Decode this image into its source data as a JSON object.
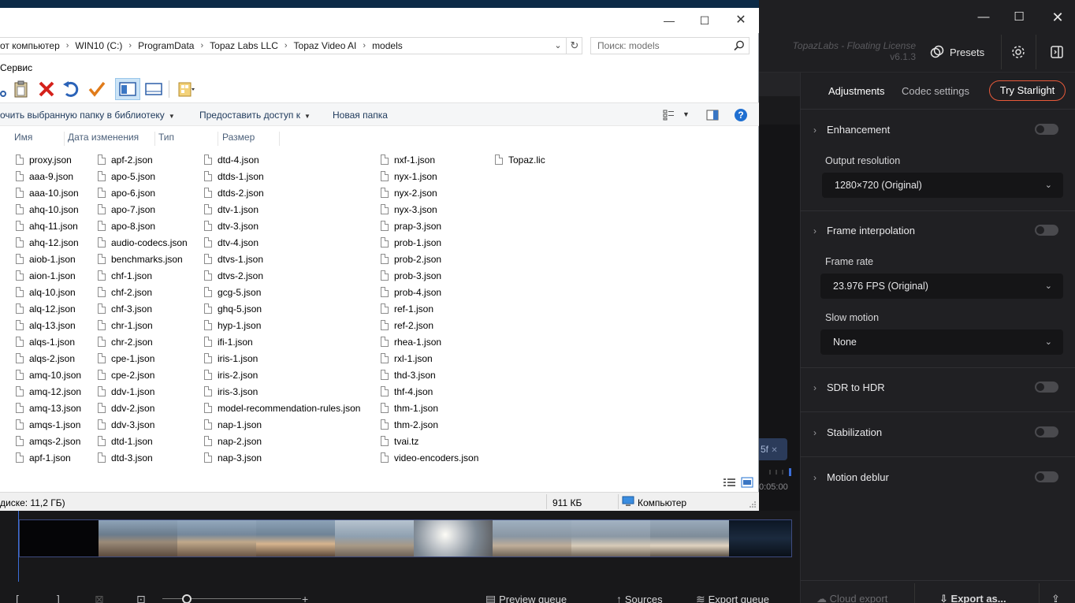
{
  "explorer": {
    "breadcrumb": [
      "от компьютер",
      "WIN10 (C:)",
      "ProgramData",
      "Topaz Labs LLC",
      "Topaz Video AI",
      "models"
    ],
    "search_placeholder": "Поиск: models",
    "menu_service": "Сервис",
    "commands": {
      "include_library": "очить выбранную папку в библиотеку",
      "share": "Предоставить доступ к",
      "new_folder": "Новая папка"
    },
    "columns": [
      "Имя",
      "Дата изменения",
      "Тип",
      "Размер"
    ],
    "files": {
      "col1": [
        "proxy.json",
        "aaa-9.json",
        "aaa-10.json",
        "ahq-10.json",
        "ahq-11.json",
        "ahq-12.json",
        "aiob-1.json",
        "aion-1.json",
        "alq-10.json",
        "alq-12.json",
        "alq-13.json",
        "alqs-1.json",
        "alqs-2.json",
        "amq-10.json",
        "amq-12.json",
        "amq-13.json",
        "amqs-1.json",
        "amqs-2.json",
        "apf-1.json"
      ],
      "col2": [
        "apf-2.json",
        "apo-5.json",
        "apo-6.json",
        "apo-7.json",
        "apo-8.json",
        "audio-codecs.json",
        "benchmarks.json",
        "chf-1.json",
        "chf-2.json",
        "chf-3.json",
        "chr-1.json",
        "chr-2.json",
        "cpe-1.json",
        "cpe-2.json",
        "ddv-1.json",
        "ddv-2.json",
        "ddv-3.json",
        "dtd-1.json",
        "dtd-3.json"
      ],
      "col3": [
        "dtd-4.json",
        "dtds-1.json",
        "dtds-2.json",
        "dtv-1.json",
        "dtv-3.json",
        "dtv-4.json",
        "dtvs-1.json",
        "dtvs-2.json",
        "gcg-5.json",
        "ghq-5.json",
        "hyp-1.json",
        "ifi-1.json",
        "iris-1.json",
        "iris-2.json",
        "iris-3.json",
        "model-recommendation-rules.json",
        "nap-1.json",
        "nap-2.json",
        "nap-3.json"
      ],
      "col4": [
        "nxf-1.json",
        "nyx-1.json",
        "nyx-2.json",
        "nyx-3.json",
        "prap-3.json",
        "prob-1.json",
        "prob-2.json",
        "prob-3.json",
        "prob-4.json",
        "ref-1.json",
        "ref-2.json",
        "rhea-1.json",
        "rxl-1.json",
        "thd-3.json",
        "thf-4.json",
        "thm-1.json",
        "thm-2.json",
        "tvai.tz",
        "video-encoders.json"
      ],
      "col5": [
        "Topaz.lic"
      ]
    },
    "status": {
      "free_space": "диске: 11,2 ГБ)",
      "size": "911 КБ",
      "location": "Компьютер"
    }
  },
  "app": {
    "license_text": "TopazLabs - Floating License",
    "version": "v6.1.3",
    "presets_label": "Presets",
    "tabs": [
      "Adjustments",
      "Codec settings"
    ],
    "starlight_label": "Try Starlight",
    "sections": {
      "enhancement": "Enhancement",
      "output_resolution_label": "Output resolution",
      "output_resolution_value": "1280×720 (Original)",
      "frame_interpolation": "Frame interpolation",
      "frame_rate_label": "Frame rate",
      "frame_rate_value": "23.976 FPS (Original)",
      "slow_motion_label": "Slow motion",
      "slow_motion_value": "None",
      "sdr_to_hdr": "SDR to HDR",
      "stabilization": "Stabilization",
      "motion_deblur": "Motion deblur"
    },
    "toggles": {
      "enhancement": false,
      "frame_interpolation": false,
      "sdr_to_hdr": false,
      "stabilization": false,
      "motion_deblur": false
    },
    "frame_chip": "5f",
    "timecode": "0:05:00",
    "bottom": {
      "preview_queue": "Preview queue",
      "sources": "Sources",
      "export_queue": "Export queue",
      "cloud_export": "Cloud export",
      "export_as": "Export as..."
    },
    "colors": {
      "accent": "#e85a3a",
      "playhead": "#3b6ed8"
    }
  }
}
